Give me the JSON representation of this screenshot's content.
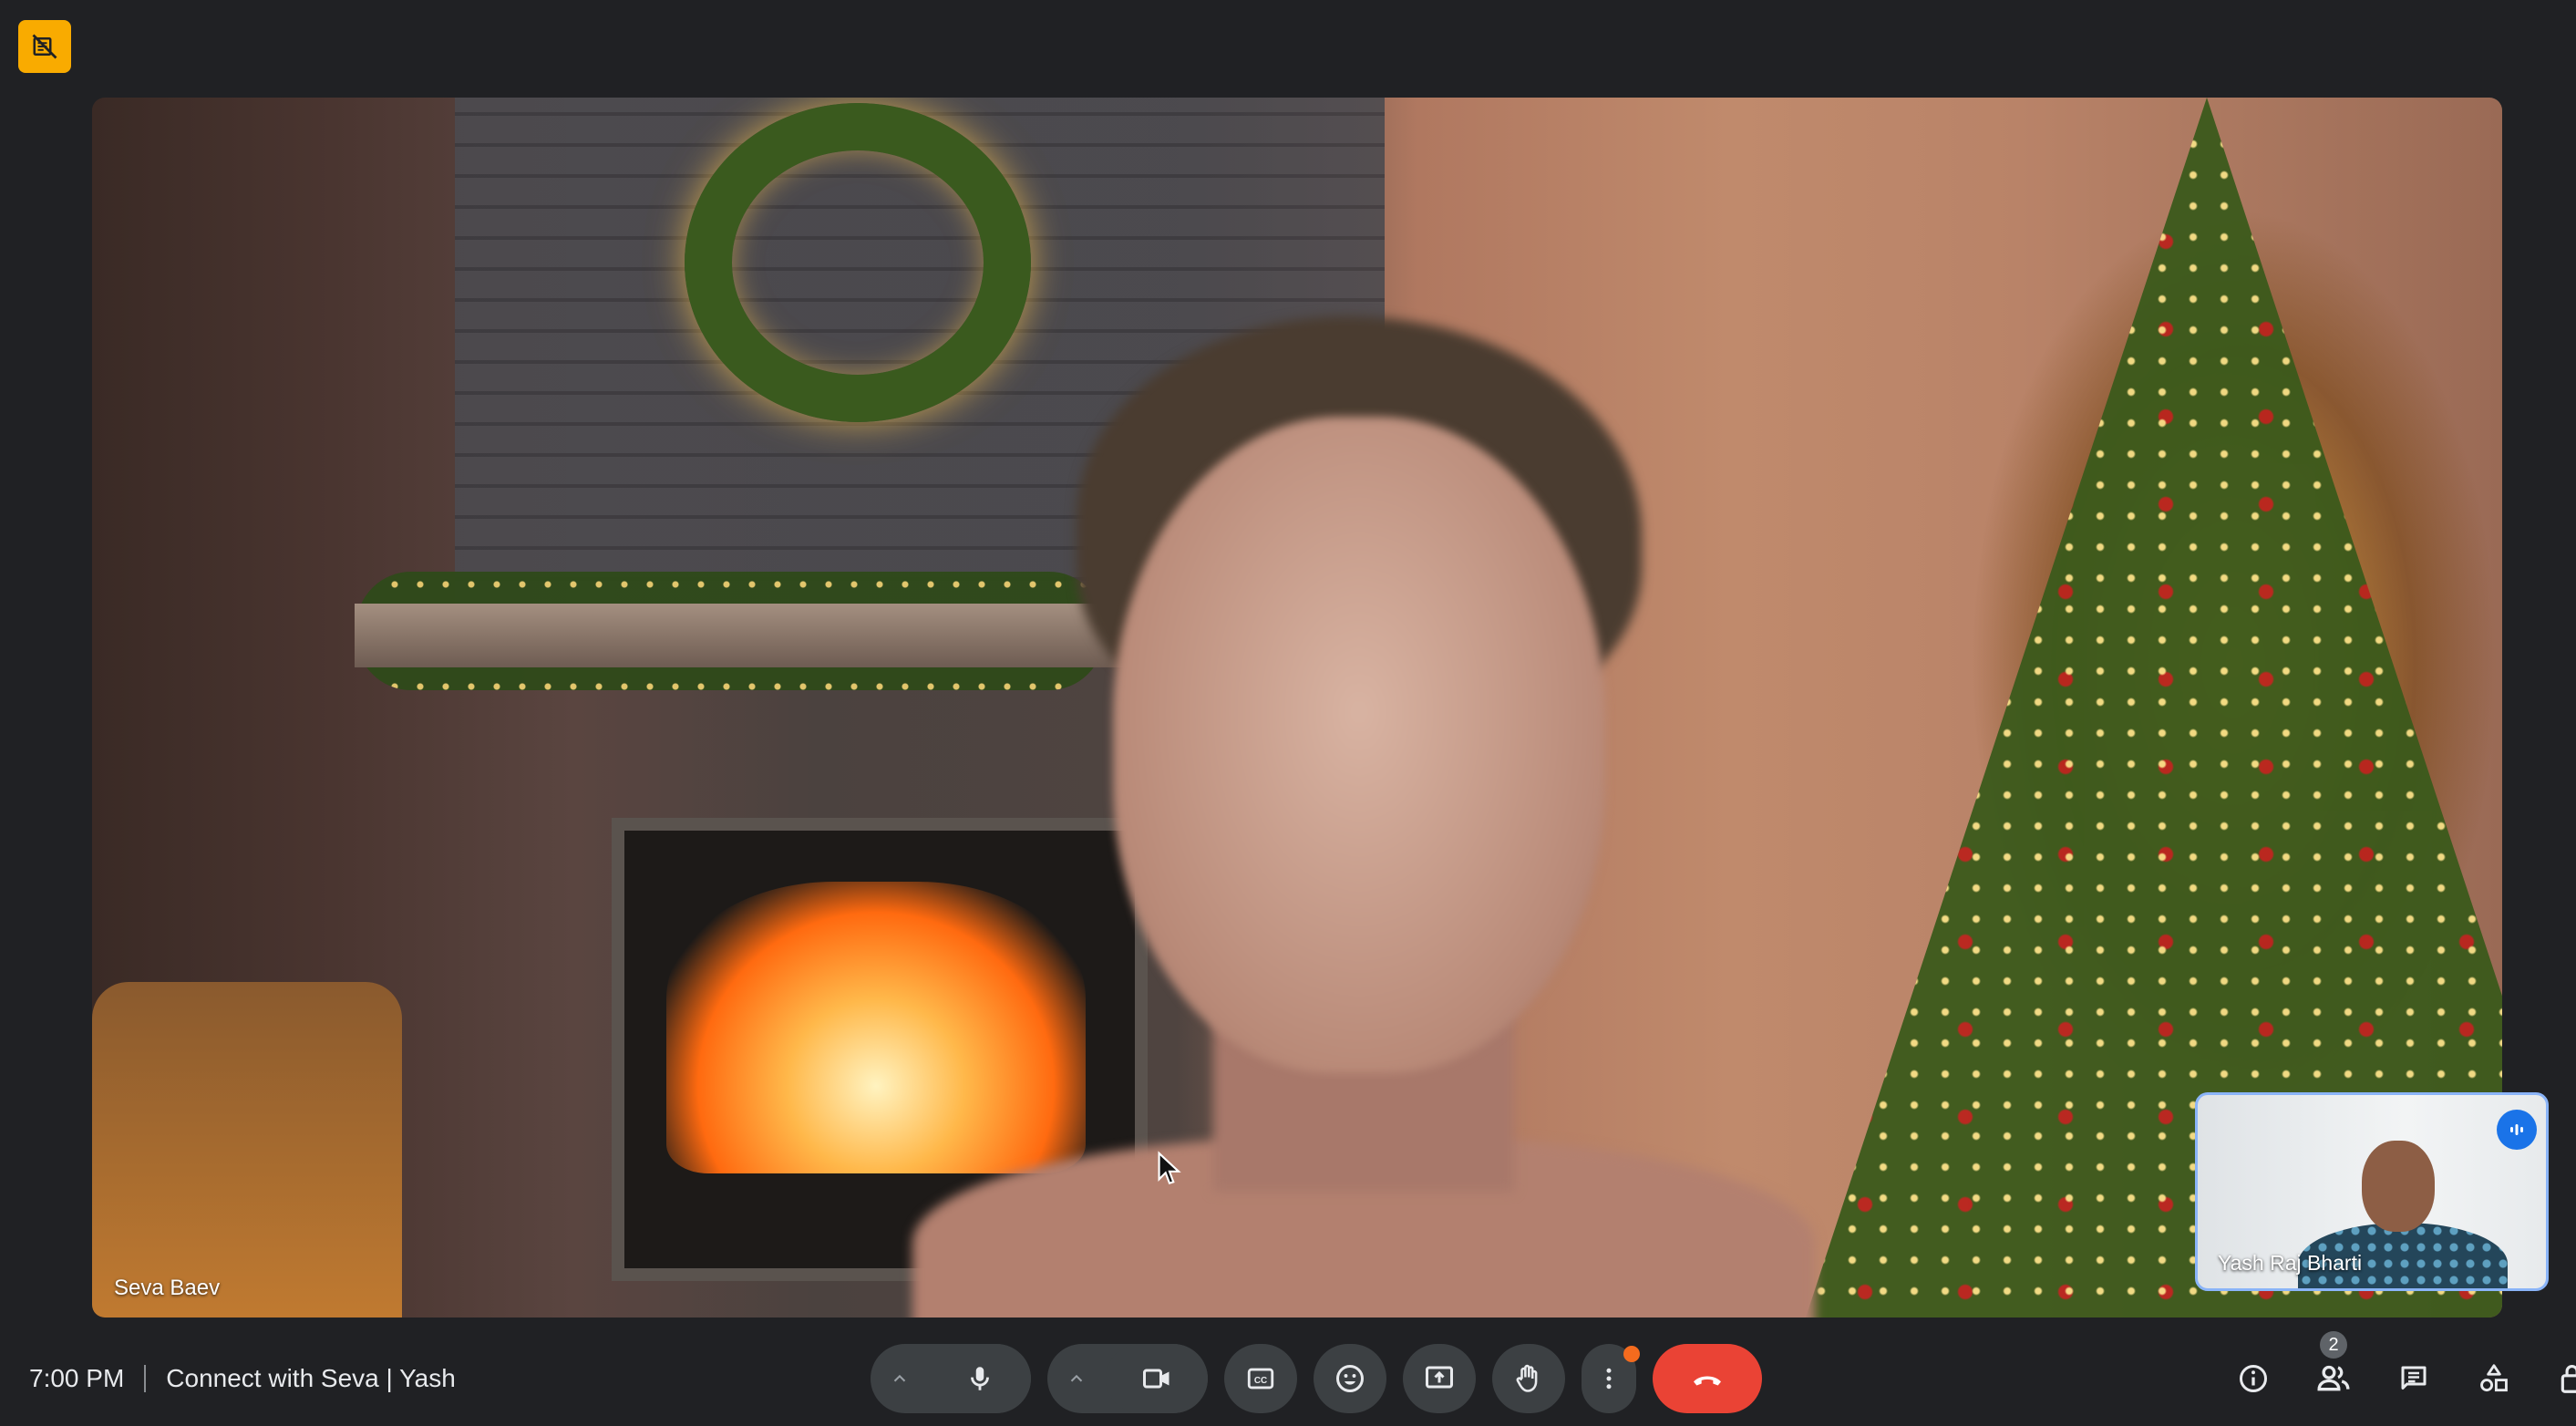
{
  "main_video": {
    "participant_name": "Seva Baev"
  },
  "self_view": {
    "participant_name": "Yash Raj Bharti"
  },
  "meeting": {
    "time": "7:00 PM",
    "title": "Connect with Seva | Yash"
  },
  "controls": {
    "people_count": "2"
  },
  "colors": {
    "background": "#202124",
    "control_bg": "#3c4043",
    "end_call": "#ea4335",
    "accent_blue": "#1a73e8",
    "recording_badge": "#f9ab00",
    "notification_dot": "#f46b1e"
  },
  "icons": [
    "no-camera-record-icon",
    "mic-icon",
    "chevron-up-icon",
    "camera-icon",
    "captions-icon",
    "emoji-icon",
    "present-screen-icon",
    "raise-hand-icon",
    "more-options-icon",
    "end-call-icon",
    "info-icon",
    "people-icon",
    "chat-icon",
    "activities-icon",
    "host-controls-icon",
    "speaking-indicator-icon"
  ]
}
